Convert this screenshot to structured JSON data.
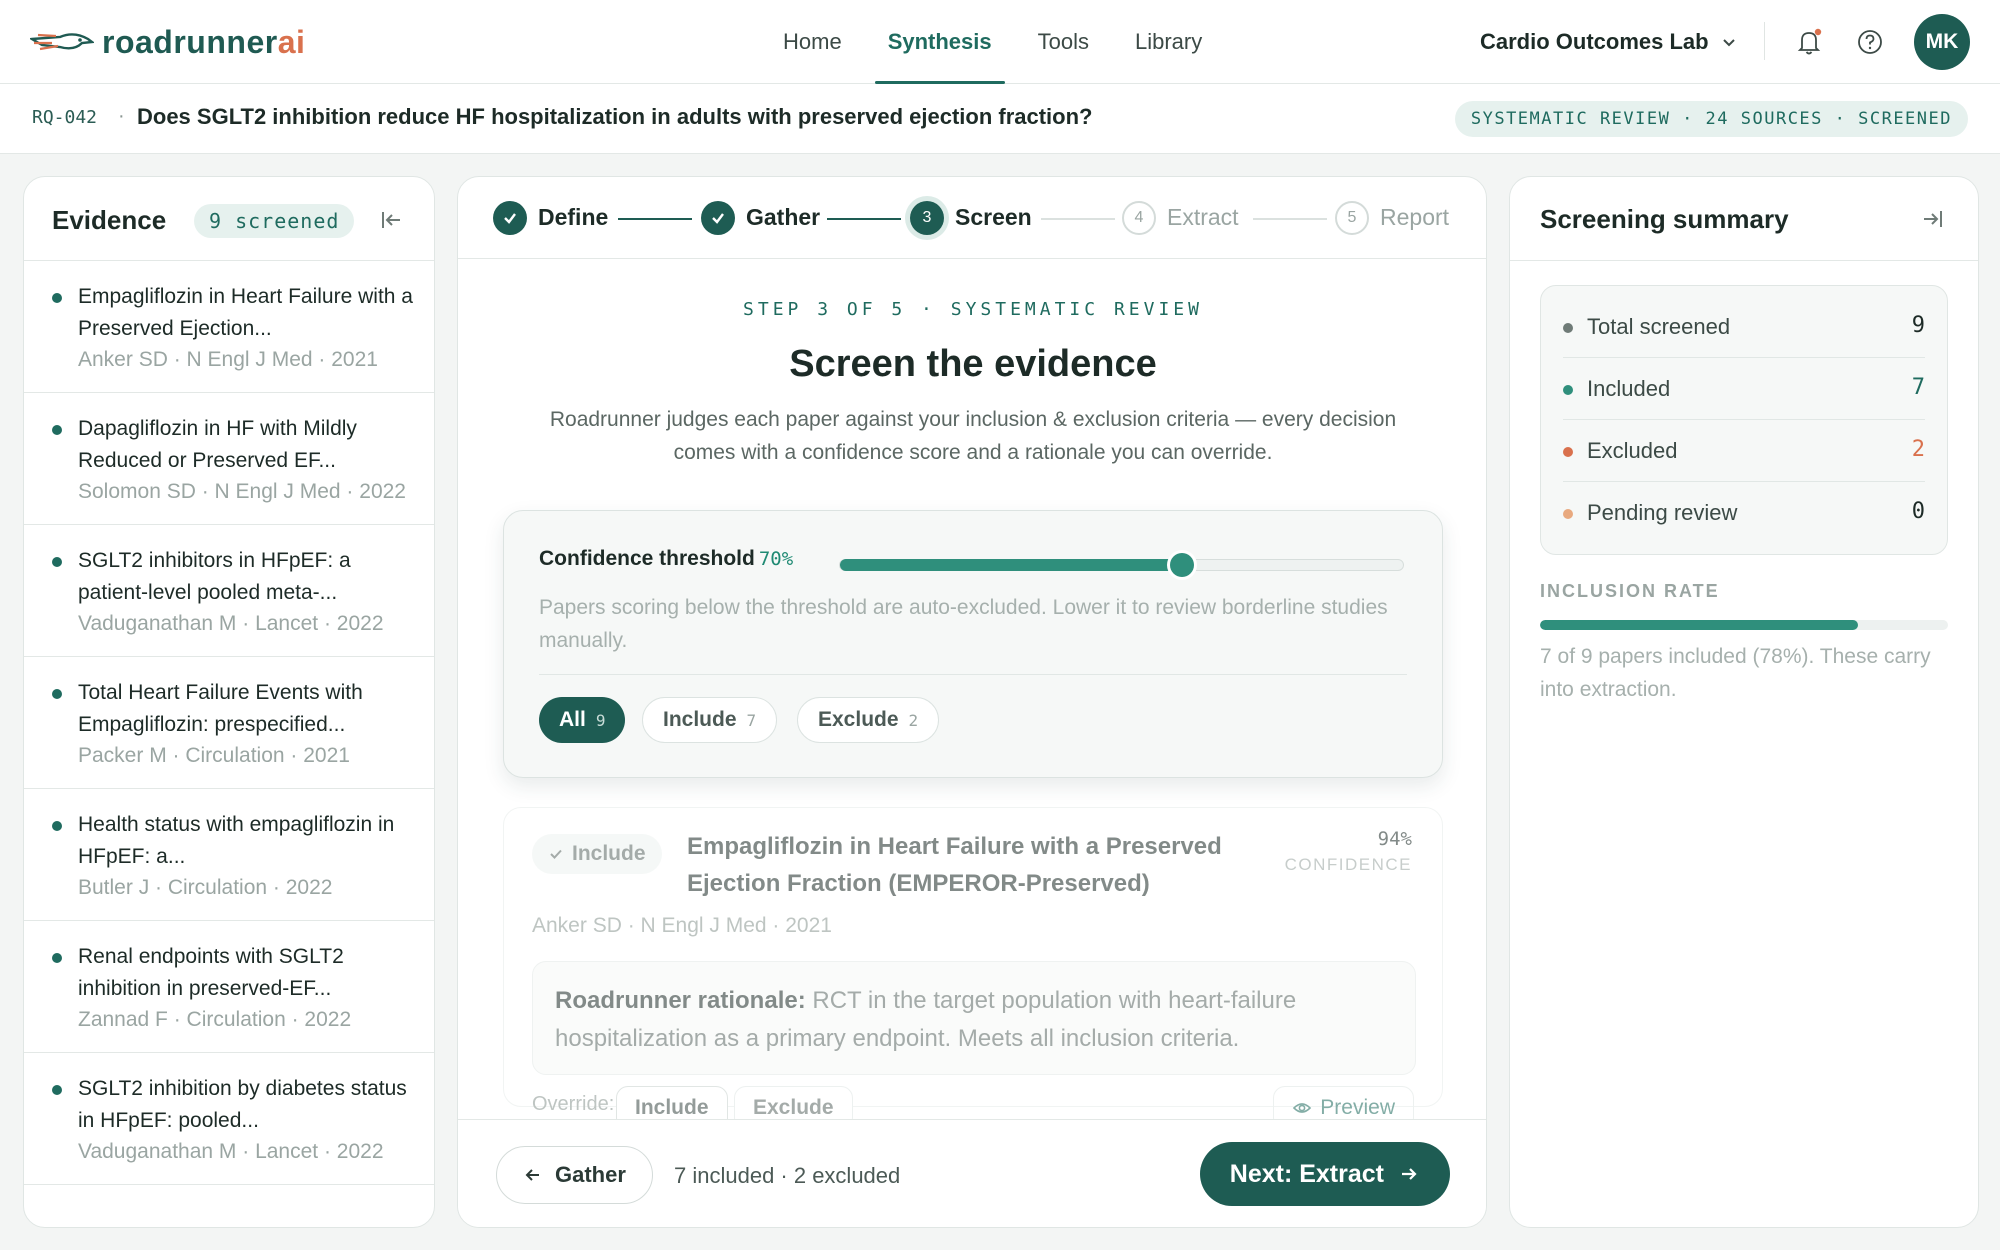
{
  "brand": {
    "name_main": "roadrunner",
    "name_accent": "ai"
  },
  "nav": {
    "items": [
      {
        "label": "Home"
      },
      {
        "label": "Synthesis",
        "active": true
      },
      {
        "label": "Tools"
      },
      {
        "label": "Library"
      }
    ],
    "workspace": "Cardio Outcomes Lab",
    "avatar_initials": "MK"
  },
  "question": {
    "id": "RQ-042",
    "separator": "·",
    "text": "Does SGLT2 inhibition reduce HF hospitalization in adults with preserved ejection fraction?",
    "badge": "SYSTEMATIC REVIEW · 24 SOURCES · SCREENED"
  },
  "evidence": {
    "title": "Evidence",
    "badge": "9 screened",
    "items": [
      {
        "title": "Empagliflozin in Heart Failure with a Preserved Ejection...",
        "meta": "Anker SD · N Engl J Med · 2021"
      },
      {
        "title": "Dapagliflozin in HF with Mildly Reduced or Preserved EF...",
        "meta": "Solomon SD · N Engl J Med · 2022"
      },
      {
        "title": "SGLT2 inhibitors in HFpEF: a patient-level pooled meta-...",
        "meta": "Vaduganathan M · Lancet · 2022"
      },
      {
        "title": "Total Heart Failure Events with Empagliflozin: prespecified...",
        "meta": "Packer M · Circulation · 2021"
      },
      {
        "title": "Health status with empagliflozin in HFpEF: a...",
        "meta": "Butler J · Circulation · 2022"
      },
      {
        "title": "Renal endpoints with SGLT2 inhibition in preserved-EF...",
        "meta": "Zannad F · Circulation · 2022"
      },
      {
        "title": "SGLT2 inhibition by diabetes status in HFpEF: pooled...",
        "meta": "Vaduganathan M · Lancet · 2022"
      }
    ]
  },
  "stepper": {
    "steps": [
      {
        "label": "Define",
        "state": "done"
      },
      {
        "label": "Gather",
        "state": "done"
      },
      {
        "label": "Screen",
        "number": "3",
        "state": "current"
      },
      {
        "label": "Extract",
        "number": "4",
        "state": "todo"
      },
      {
        "label": "Report",
        "number": "5",
        "state": "todo"
      }
    ]
  },
  "main": {
    "eyebrow": "STEP 3 OF 5 · SYSTEMATIC REVIEW",
    "title": "Screen the evidence",
    "subtitle": "Roadrunner judges each paper against your inclusion & exclusion criteria — every decision comes with a confidence score and a rationale you can override."
  },
  "threshold": {
    "label": "Confidence threshold",
    "value_text": "70%",
    "value": 0.7,
    "help": "Papers scoring below the threshold are auto-excluded. Lower it to review borderline studies manually.",
    "filters": [
      {
        "label": "All",
        "count": "9",
        "active": true
      },
      {
        "label": "Include",
        "count": "7"
      },
      {
        "label": "Exclude",
        "count": "2"
      }
    ]
  },
  "paper": {
    "decision": "Include",
    "title": "Empagliflozin in Heart Failure with a Preserved Ejection Fraction (EMPEROR-Preserved)",
    "confidence": "94%",
    "confidence_label": "CONFIDENCE",
    "meta": "Anker SD · N Engl J Med · 2021",
    "rationale_label": "Roadrunner rationale:",
    "rationale": "RCT in the target population with heart-failure hospitalization as a primary endpoint. Meets all inclusion criteria.",
    "override_label": "Override:",
    "override_include": "Include",
    "override_exclude": "Exclude",
    "preview": "Preview"
  },
  "footer": {
    "back_label": "Gather",
    "status": "7 included · 2 excluded",
    "next_label": "Next: Extract"
  },
  "summary": {
    "title": "Screening summary",
    "stats": [
      {
        "label": "Total screened",
        "value": "9",
        "dot": "#6f7b77",
        "value_color": "#1d2b27"
      },
      {
        "label": "Included",
        "value": "7",
        "dot": "#2f8f7c",
        "value_color": "#1f6b5f"
      },
      {
        "label": "Excluded",
        "value": "2",
        "dot": "#d9714d",
        "value_color": "#d9714d"
      },
      {
        "label": "Pending review",
        "value": "0",
        "dot": "#e8a97f",
        "value_color": "#1d2b27"
      }
    ],
    "rate_heading": "INCLUSION RATE",
    "rate_value": 0.78,
    "rate_note": "7 of 9 papers included (78%). These carry into extraction."
  },
  "colors": {
    "accent": "#1e5c53",
    "accent_light": "#2f8f7c",
    "warn": "#d9714d"
  }
}
